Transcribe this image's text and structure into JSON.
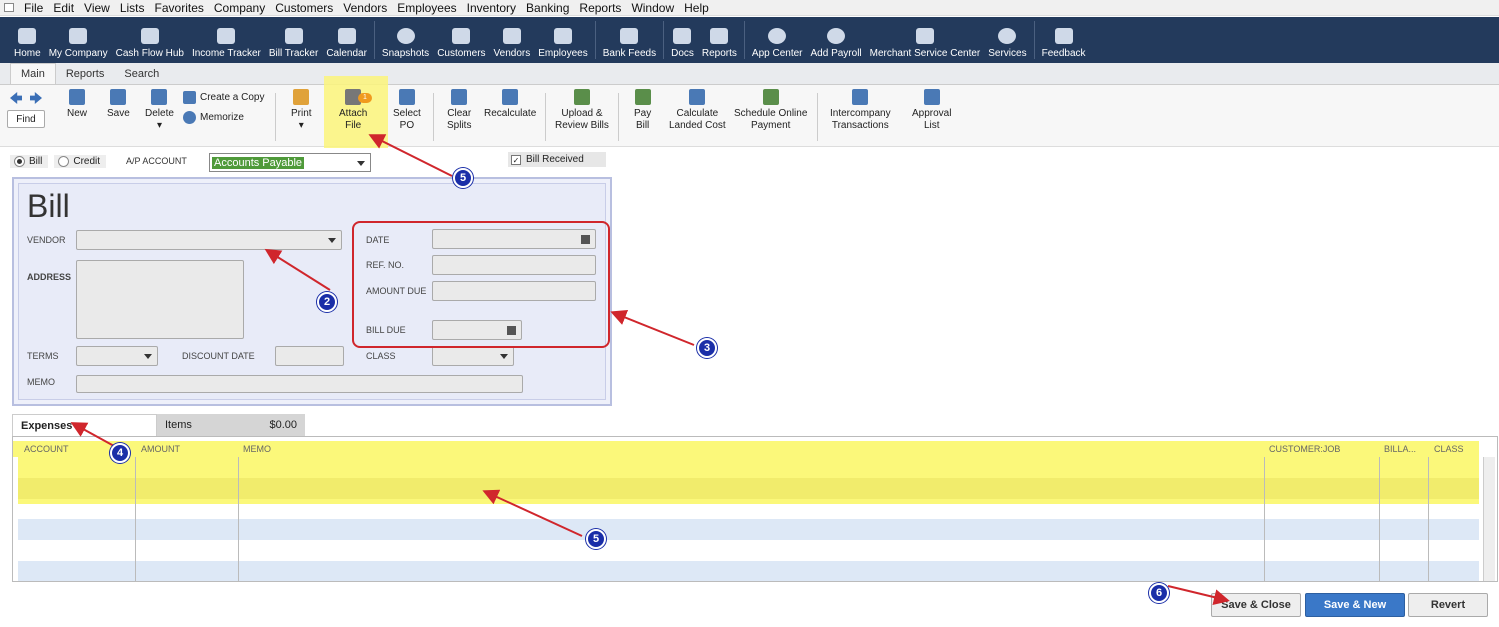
{
  "menu": [
    "File",
    "Edit",
    "View",
    "Lists",
    "Favorites",
    "Company",
    "Customers",
    "Vendors",
    "Employees",
    "Inventory",
    "Banking",
    "Reports",
    "Window",
    "Help"
  ],
  "nav": [
    {
      "label": "Home",
      "icon": "home-icon"
    },
    {
      "label": "My Company",
      "icon": "company-icon"
    },
    {
      "label": "Cash Flow Hub",
      "icon": "cashflow-icon"
    },
    {
      "label": "Income Tracker",
      "icon": "income-icon"
    },
    {
      "label": "Bill Tracker",
      "icon": "bill-icon"
    },
    {
      "label": "Calendar",
      "icon": "calendar-icon"
    },
    {
      "label": "Snapshots",
      "icon": "pie-icon"
    },
    {
      "label": "Customers",
      "icon": "customer-icon"
    },
    {
      "label": "Vendors",
      "icon": "vendor-icon"
    },
    {
      "label": "Employees",
      "icon": "employee-icon"
    },
    {
      "label": "Bank Feeds",
      "icon": "bank-icon"
    },
    {
      "label": "Docs",
      "icon": "docs-icon"
    },
    {
      "label": "Reports",
      "icon": "reports-icon"
    },
    {
      "label": "App Center",
      "icon": "app-icon"
    },
    {
      "label": "Add Payroll",
      "icon": "payroll-icon"
    },
    {
      "label": "Merchant Service Center",
      "icon": "merchant-icon"
    },
    {
      "label": "Services",
      "icon": "plus-icon"
    },
    {
      "label": "Feedback",
      "icon": "feedback-icon"
    }
  ],
  "tabs": [
    "Main",
    "Reports",
    "Search"
  ],
  "toolbar": {
    "find": "Find",
    "new": "New",
    "save": "Save",
    "delete": "Delete",
    "create_copy": "Create a Copy",
    "memorize": "Memorize",
    "print": "Print",
    "attach_1": "Attach",
    "attach_2": "File",
    "attach_badge": "1",
    "select_1": "Select",
    "select_2": "PO",
    "clear_1": "Clear",
    "clear_2": "Splits",
    "recalc": "Recalculate",
    "upload_1": "Upload &",
    "upload_2": "Review Bills",
    "pay_1": "Pay",
    "pay_2": "Bill",
    "calc_1": "Calculate",
    "calc_2": "Landed Cost",
    "sched_1": "Schedule Online",
    "sched_2": "Payment",
    "inter_1": "Intercompany",
    "inter_2": "Transactions",
    "approval_1": "Approval",
    "approval_2": "List"
  },
  "form": {
    "radio_bill": "Bill",
    "radio_credit": "Credit",
    "ap_account_label": "A/P ACCOUNT",
    "ap_account_value": "Accounts Payable",
    "bill_received": "Bill Received",
    "title": "Bill",
    "vendor": "VENDOR",
    "address": "ADDRESS",
    "terms": "TERMS",
    "discount_date": "DISCOUNT DATE",
    "class": "CLASS",
    "memo": "MEMO",
    "date": "DATE",
    "ref_no": "REF. NO.",
    "amount_due": "AMOUNT DUE",
    "bill_due": "BILL DUE"
  },
  "subtabs": {
    "expenses": "Expenses",
    "items": "Items",
    "items_amount": "$0.00"
  },
  "grid": {
    "headers": [
      "ACCOUNT",
      "AMOUNT",
      "MEMO",
      "CUSTOMER:JOB",
      "BILLA...",
      "CLASS"
    ]
  },
  "buttons": {
    "save_close": "Save & Close",
    "save_new": "Save & New",
    "revert": "Revert"
  },
  "callouts": [
    "5",
    "2",
    "3",
    "4",
    "5",
    "6"
  ],
  "colors": {
    "nav_bg": "#233a5c",
    "highlight": "#fbf87a",
    "callout": "#1a2ea8",
    "arrow": "#d0262c"
  }
}
